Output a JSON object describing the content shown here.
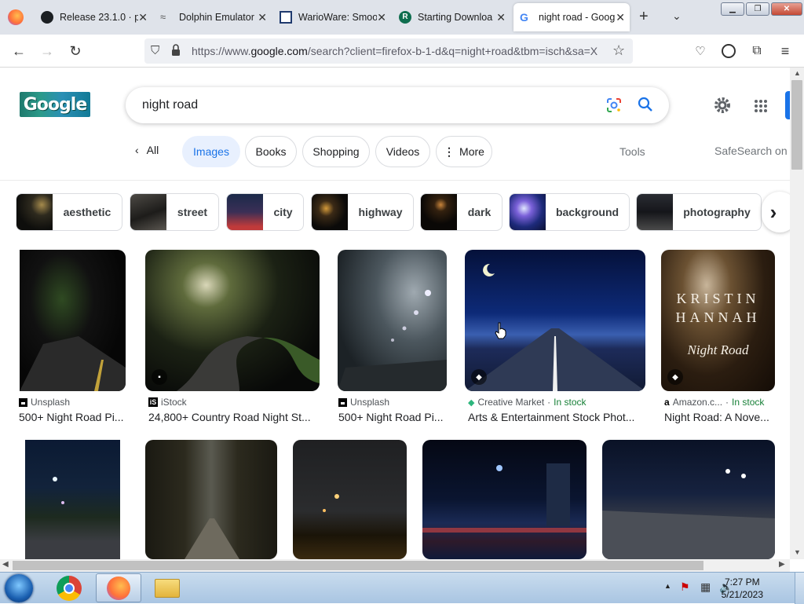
{
  "browser": {
    "tabs": [
      {
        "label": "Release 23.1.0 · pa",
        "icon": "github-icon"
      },
      {
        "label": "Dolphin Emulator",
        "icon": "dolphin-icon"
      },
      {
        "label": "WarioWare: Smoo",
        "icon": "warioware-icon"
      },
      {
        "label": "Starting Downloa",
        "icon": "r-site-icon"
      },
      {
        "label": "night road - Goog",
        "icon": "google-icon"
      }
    ],
    "url_prefix": "https://www.",
    "url_domain": "google.com",
    "url_path": "/search?client=firefox-b-1-d&q=night+road&tbm=isch&sa=X"
  },
  "search": {
    "logo_text": "Google",
    "query": "night road"
  },
  "filters": {
    "all": "All",
    "images": "Images",
    "books": "Books",
    "shopping": "Shopping",
    "videos": "Videos",
    "more": "More",
    "tools": "Tools",
    "safesearch": "SafeSearch on"
  },
  "chips": [
    "aesthetic",
    "street",
    "city",
    "highway",
    "dark",
    "background",
    "photography"
  ],
  "results": [
    {
      "source": "Unsplash",
      "caption": "500+ Night Road Pi...",
      "stock": ""
    },
    {
      "source": "iStock",
      "caption": "24,800+ Country Road Night St...",
      "stock": ""
    },
    {
      "source": "Unsplash",
      "caption": "500+ Night Road Pi...",
      "stock": ""
    },
    {
      "source": "Creative Market",
      "caption": "Arts & Entertainment Stock Phot...",
      "stock": "In stock"
    },
    {
      "source": "Amazon.c...",
      "caption": "Night Road: A Nove...",
      "stock": "In stock"
    }
  ],
  "book_cover": {
    "author_line1": "KRISTIN",
    "author_line2": "HANNAH",
    "title": "Night Road"
  },
  "taskbar": {
    "time": "7:27 PM",
    "date": "5/21/2023"
  },
  "colors": {
    "accent": "#1a73e8",
    "stock_green": "#188038"
  }
}
